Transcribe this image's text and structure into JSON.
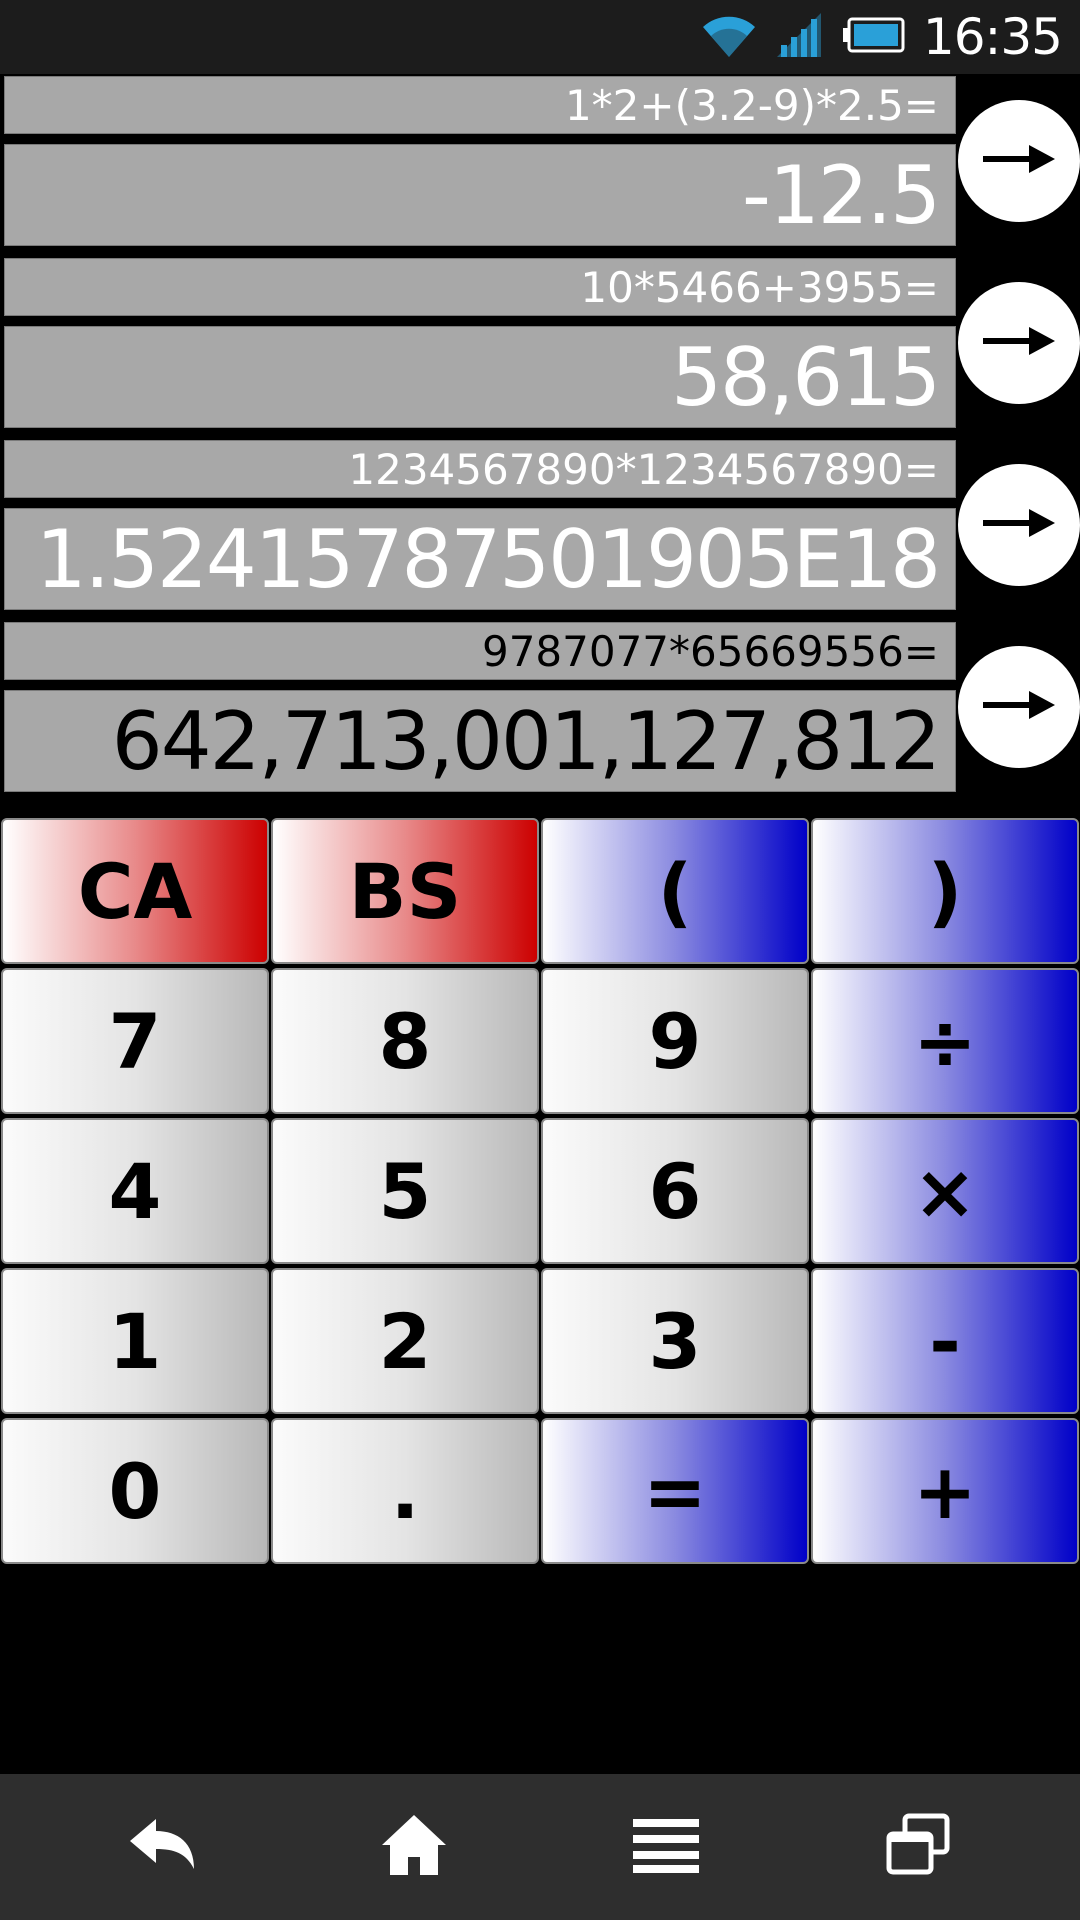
{
  "status": {
    "time": "16:35"
  },
  "history": [
    {
      "expression": "1*2+(3.2-9)*2.5=",
      "result": "-12.5",
      "dark": false
    },
    {
      "expression": "10*5466+3955=",
      "result": "58,615",
      "dark": false
    },
    {
      "expression": "1234567890*1234567890=",
      "result": "1.52415787501905E18",
      "dark": false
    },
    {
      "expression": "9787077*65669556=",
      "result": "642,713,001,127,812",
      "dark": true
    }
  ],
  "keys": [
    {
      "label": "CA",
      "style": "red",
      "name": "clear-all-button"
    },
    {
      "label": "BS",
      "style": "red",
      "name": "backspace-button"
    },
    {
      "label": "(",
      "style": "blue",
      "name": "open-paren-button"
    },
    {
      "label": ")",
      "style": "blue",
      "name": "close-paren-button"
    },
    {
      "label": "7",
      "style": "gray",
      "name": "digit-7-button"
    },
    {
      "label": "8",
      "style": "gray",
      "name": "digit-8-button"
    },
    {
      "label": "9",
      "style": "gray",
      "name": "digit-9-button"
    },
    {
      "label": "÷",
      "style": "blue",
      "name": "divide-button"
    },
    {
      "label": "4",
      "style": "gray",
      "name": "digit-4-button"
    },
    {
      "label": "5",
      "style": "gray",
      "name": "digit-5-button"
    },
    {
      "label": "6",
      "style": "gray",
      "name": "digit-6-button"
    },
    {
      "label": "×",
      "style": "blue",
      "name": "multiply-button"
    },
    {
      "label": "1",
      "style": "gray",
      "name": "digit-1-button"
    },
    {
      "label": "2",
      "style": "gray",
      "name": "digit-2-button"
    },
    {
      "label": "3",
      "style": "gray",
      "name": "digit-3-button"
    },
    {
      "label": "-",
      "style": "blue",
      "name": "subtract-button"
    },
    {
      "label": "0",
      "style": "gray",
      "name": "digit-0-button"
    },
    {
      "label": ".",
      "style": "gray",
      "name": "decimal-point-button"
    },
    {
      "label": "=",
      "style": "blue",
      "name": "equals-button"
    },
    {
      "label": "+",
      "style": "blue",
      "name": "add-button"
    }
  ],
  "icons": {
    "wifi": "wifi-icon",
    "signal": "signal-icon",
    "battery": "battery-icon",
    "arrow": "arrow-right-icon",
    "back": "back-icon",
    "home": "home-icon",
    "menu": "menu-icon",
    "recents": "recent-apps-icon"
  },
  "colors": {
    "accent_red": "#cc0000",
    "accent_blue": "#0000c8",
    "display_gray": "#a8a8a8"
  }
}
